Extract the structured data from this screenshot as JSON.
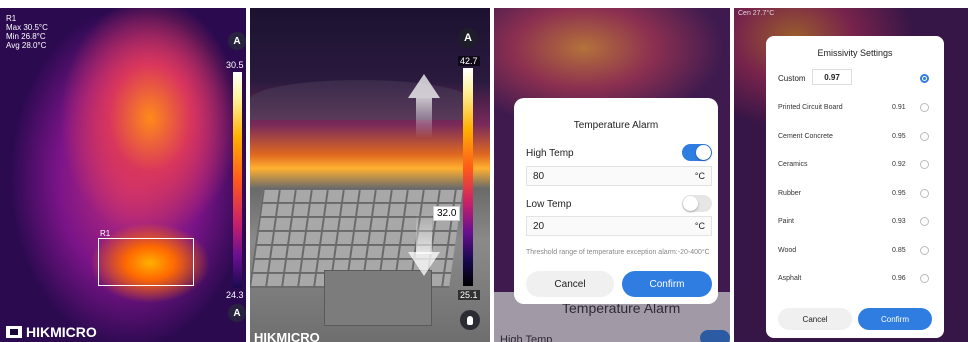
{
  "panel1": {
    "region_label": "R1",
    "readout": {
      "r": "R1",
      "max": "Max 30.5°C",
      "min": "Min 26.8°C",
      "avg": "Avg 28.0°C"
    },
    "scale_top": "30.5",
    "scale_bottom": "24.3",
    "scale_mode": "A",
    "brand": "HIKMICRO",
    "icons": [
      "auto-scale-icon",
      "hikmicro-logo-icon"
    ]
  },
  "panel2": {
    "scale_mode": "A",
    "scale_top": "42.7",
    "scale_bottom": "25.1",
    "marker_value": "32.0",
    "brand": "HIKMICRO",
    "icons": [
      "arrow-up-icon",
      "arrow-down-icon",
      "hand-pointer-icon"
    ]
  },
  "alarm": {
    "title": "Temperature Alarm",
    "high": {
      "label": "High Temp",
      "enabled": true,
      "value": "80",
      "unit": "°C"
    },
    "low": {
      "label": "Low Temp",
      "enabled": false,
      "value": "20",
      "unit": "°C"
    },
    "hint": "Threshold range of temperature exception alarm:-20-400°C",
    "cancel": "Cancel",
    "confirm": "Confirm",
    "bg_title": "Temperature Alarm",
    "bg_row": "High Temp",
    "colors": {
      "accent": "#2f7de1"
    }
  },
  "emissivity": {
    "top_readout": "Cen 27.7°C",
    "title": "Emissivity Settings",
    "custom_label": "Custom",
    "custom_value": "0.97",
    "selected": "custom",
    "materials": [
      {
        "name": "Printed Circuit Board",
        "value": "0.91"
      },
      {
        "name": "Cement Concrete",
        "value": "0.95"
      },
      {
        "name": "Ceramics",
        "value": "0.92"
      },
      {
        "name": "Rubber",
        "value": "0.95"
      },
      {
        "name": "Paint",
        "value": "0.93"
      },
      {
        "name": "Wood",
        "value": "0.85"
      },
      {
        "name": "Asphalt",
        "value": "0.96"
      }
    ],
    "cancel": "Cancel",
    "confirm": "Confirm"
  }
}
